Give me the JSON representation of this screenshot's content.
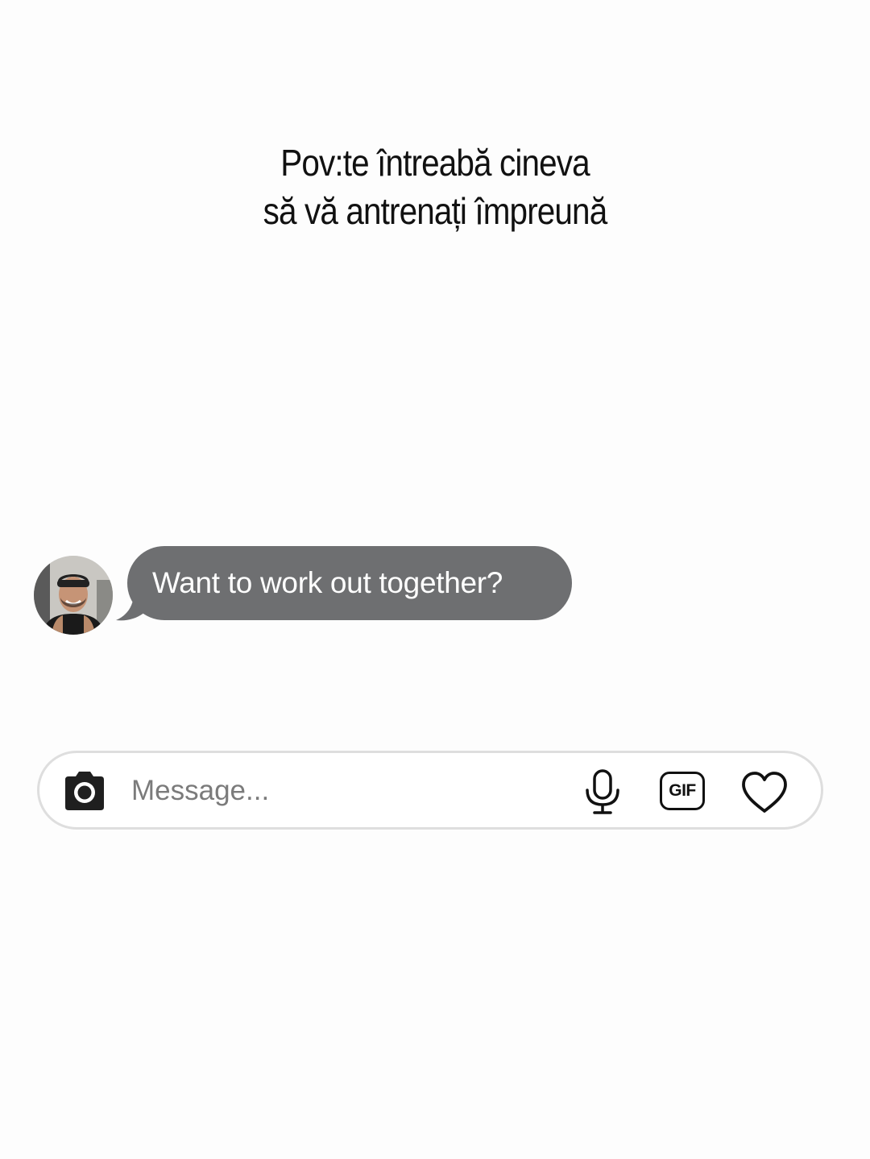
{
  "caption": {
    "line1": "Pov:te întreabă cineva",
    "line2": "să vă antrenați împreună"
  },
  "message": {
    "text": "Want to work out together?",
    "bubble_color": "#6e6f71"
  },
  "composer": {
    "placeholder": "Message...",
    "gif_label": "GIF",
    "icons": [
      "camera-icon",
      "microphone-icon",
      "gif-icon",
      "heart-icon"
    ]
  }
}
